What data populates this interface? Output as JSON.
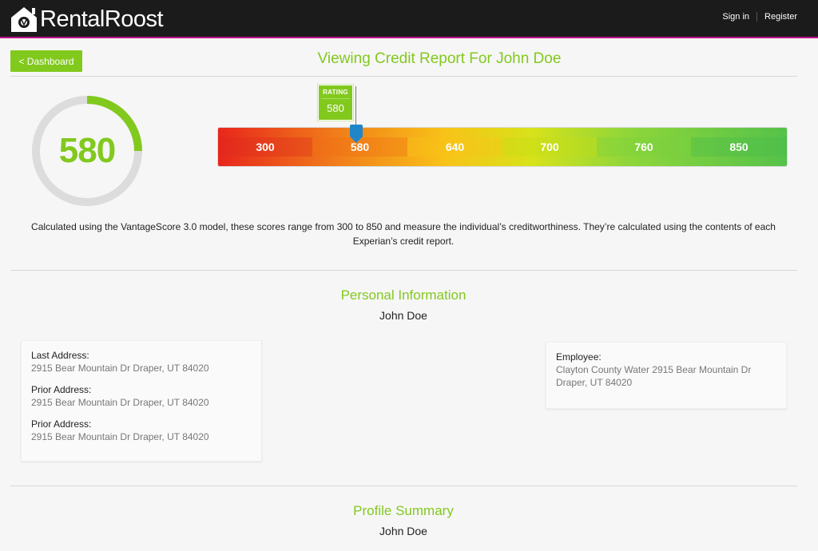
{
  "app": {
    "brand": "RentalRoost"
  },
  "nav": {
    "sign_in": "Sign in",
    "register": "Register"
  },
  "header": {
    "back_label": "< Dashboard",
    "title": "Viewing Credit Report For John Doe"
  },
  "score": {
    "value": "580",
    "fraction": 0.25,
    "rating_label": "RATING",
    "rating_value": "580",
    "scale_ticks": [
      "300",
      "580",
      "640",
      "700",
      "760",
      "850"
    ],
    "colors": {
      "accent": "#82c91e",
      "gauge_track": "#dcdcdc",
      "marker": "#1f86c9"
    }
  },
  "description": "Calculated using the VantageScore 3.0 model, these scores range from 300 to 850 and measure the individual’s creditworthiness. They’re calculated using the contents of each Experian’s credit report.",
  "personal": {
    "title": "Personal Information",
    "name": "John Doe",
    "addresses": [
      {
        "label": "Last Address:",
        "value": "2915 Bear Mountain Dr Draper, UT 84020"
      },
      {
        "label": "Prior Address:",
        "value": "2915 Bear Mountain Dr Draper, UT 84020"
      },
      {
        "label": "Prior Address:",
        "value": "2915 Bear Mountain Dr Draper, UT 84020"
      }
    ],
    "employment": {
      "label": "Employee:",
      "value": "Clayton County Water 2915 Bear Mountain Dr Draper, UT 84020"
    }
  },
  "profile": {
    "title": "Profile Summary",
    "name": "John Doe"
  }
}
